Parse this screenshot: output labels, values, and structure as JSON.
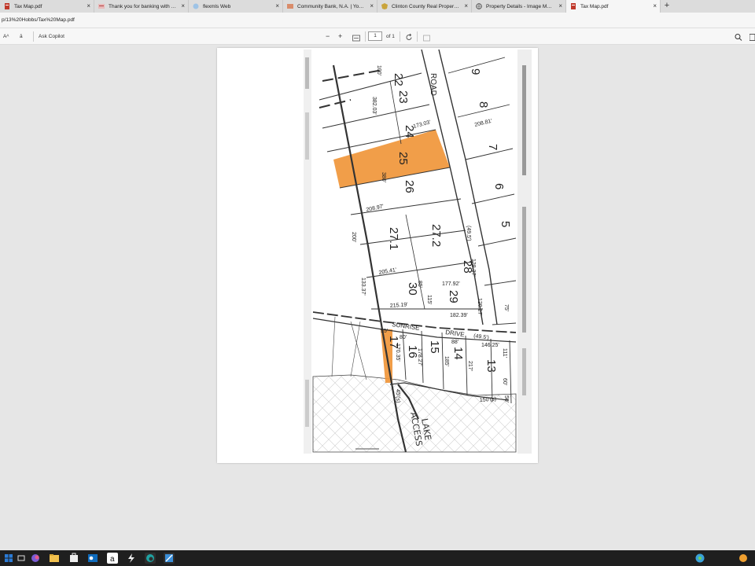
{
  "browser": {
    "tabs": [
      {
        "label": "Tax Map.pdf",
        "icon": "pdf-icon"
      },
      {
        "label": "Thank you for banking with us. | C",
        "icon": "bank-icon"
      },
      {
        "label": "flexmls Web",
        "icon": "flexmls-icon"
      },
      {
        "label": "Community Bank, N.A. | Your Trus",
        "icon": "bank-icon"
      },
      {
        "label": "Clinton County Real Property Offi",
        "icon": "county-seal-icon"
      },
      {
        "label": "Property Details - Image Mate O",
        "icon": "globe-icon"
      },
      {
        "label": "Tax Map.pdf",
        "icon": "pdf-icon"
      }
    ],
    "new_tab": "+",
    "close": "×",
    "url": "p/13%20Hobbs/Tax%20Map.pdf"
  },
  "pdf_toolbar": {
    "read_aloud": "Aᴬ",
    "translate": "ā",
    "ask_copilot": "Ask Copilot",
    "zoom_out": "−",
    "zoom_in": "+",
    "page_number": "1",
    "page_count": "of 1"
  },
  "map": {
    "lots": [
      "22",
      "23",
      "24",
      "25",
      "26",
      "27.1",
      "27.2",
      "28",
      "29",
      "30",
      "9",
      "8",
      "7",
      "6",
      "5",
      "17",
      "16",
      "15",
      "14",
      "13"
    ],
    "roads": [
      "ROAD",
      "SUNRISE",
      "DRIVE",
      "(49.5')",
      "(49.5')"
    ],
    "dimensions": [
      "100'",
      "382.03'",
      "173.03'",
      "380'",
      "208.97'",
      "200'",
      "205.41'",
      "215.19'",
      "133.37'",
      "177.92'",
      "182.39'",
      "120.27'",
      "138.37'",
      "170.35'",
      "178.27'",
      "146.25'",
      "150'(s)",
      "208.81'",
      "80'",
      "88'",
      "55'",
      "185'",
      "217'",
      "111'",
      "60'",
      "115'",
      "85'",
      "75'",
      "45'(s)",
      "50'"
    ],
    "handwriting": [
      "LAKE",
      "ACCESS"
    ]
  },
  "colors": {
    "highlight": "#f0963a",
    "tab_bar": "#dcdcdc",
    "taskbar": "#1f1f1f"
  }
}
